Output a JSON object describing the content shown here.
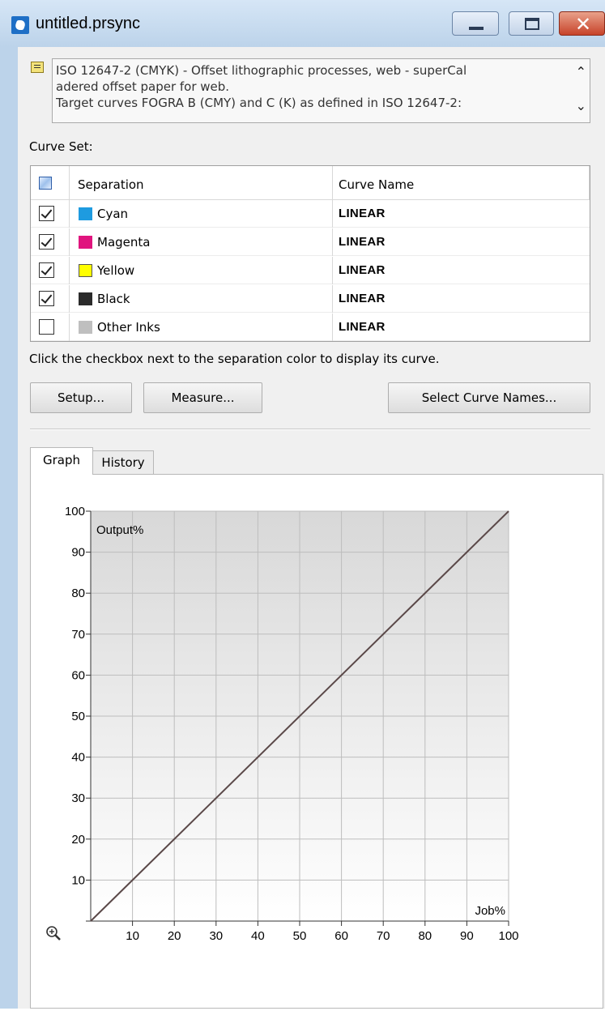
{
  "window": {
    "title": "untitled.prsync",
    "minimize_icon": "minimize-icon",
    "maximize_icon": "maximize-icon",
    "close_icon": "close-icon"
  },
  "description": {
    "text": "ISO 12647-2 (CMYK) - Offset lithographic processes, web - superCalendered offset paper for web.\nTarget curves FOGRA B (CMY) and C (K) as defined in ISO 12647-2:",
    "line1": "ISO 12647-2 (CMYK) - Offset lithographic processes, web - superCal",
    "line2": "adered offset paper for web.",
    "line3": "Target curves FOGRA B (CMY) and C (K) as defined in ISO 12647-2:"
  },
  "curve_set": {
    "label": "Curve Set:",
    "columns": {
      "separation": "Separation",
      "curve_name": "Curve Name"
    },
    "rows": [
      {
        "checked": true,
        "color": "#1e9be0",
        "separation": "Cyan",
        "curve_name": "LINEAR"
      },
      {
        "checked": true,
        "color": "#e0147e",
        "separation": "Magenta",
        "curve_name": "LINEAR"
      },
      {
        "checked": true,
        "color": "#ffff00",
        "separation": "Yellow",
        "curve_name": "LINEAR"
      },
      {
        "checked": true,
        "color": "#2b2b2b",
        "separation": "Black",
        "curve_name": "LINEAR"
      },
      {
        "checked": false,
        "color": "#bfbfbf",
        "separation": "Other Inks",
        "curve_name": "LINEAR"
      }
    ]
  },
  "hint": "Click the checkbox next to the separation color to display its curve.",
  "buttons": {
    "setup": "Setup...",
    "measure": "Measure...",
    "select_curve_names": "Select Curve Names..."
  },
  "tabs": {
    "graph": "Graph",
    "history": "History",
    "active": "Graph"
  },
  "chart_data": {
    "type": "line",
    "xlabel": "Job%",
    "ylabel": "Output%",
    "xlim": [
      0,
      100
    ],
    "ylim": [
      0,
      100
    ],
    "x_ticks": [
      10,
      20,
      30,
      40,
      50,
      60,
      70,
      80,
      90,
      100
    ],
    "y_ticks": [
      10,
      20,
      30,
      40,
      50,
      60,
      70,
      80,
      90,
      100
    ],
    "grid": true,
    "series": [
      {
        "x": [
          0,
          100
        ],
        "y": [
          0,
          100
        ],
        "color": "#5a4848"
      }
    ],
    "zoom_icon": "zoom-in-icon"
  }
}
